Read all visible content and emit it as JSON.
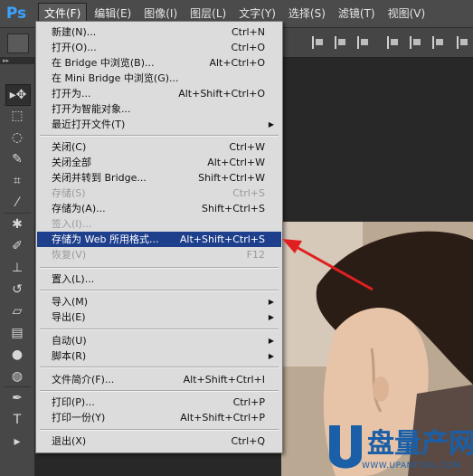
{
  "app": {
    "logo": "Ps"
  },
  "menubar": {
    "items": [
      {
        "label": "文件(F)"
      },
      {
        "label": "编辑(E)"
      },
      {
        "label": "图像(I)"
      },
      {
        "label": "图层(L)"
      },
      {
        "label": "文字(Y)"
      },
      {
        "label": "选择(S)"
      },
      {
        "label": "滤镜(T)"
      },
      {
        "label": "视图(V)"
      }
    ]
  },
  "panel_strip": {
    "label": "▸▸"
  },
  "toolbar": {
    "tools": [
      {
        "icon": "move-tool-icon",
        "glyph": "▸✥"
      },
      {
        "icon": "marquee-tool-icon",
        "glyph": "⬚"
      },
      {
        "icon": "lasso-tool-icon",
        "glyph": "◌"
      },
      {
        "icon": "quick-select-tool-icon",
        "glyph": "✎"
      },
      {
        "icon": "crop-tool-icon",
        "glyph": "⌗"
      },
      {
        "icon": "eyedropper-tool-icon",
        "glyph": "⁄"
      },
      {
        "icon": "healing-brush-tool-icon",
        "glyph": "✱"
      },
      {
        "icon": "brush-tool-icon",
        "glyph": "✐"
      },
      {
        "icon": "clone-stamp-tool-icon",
        "glyph": "⊥"
      },
      {
        "icon": "history-brush-tool-icon",
        "glyph": "↺"
      },
      {
        "icon": "eraser-tool-icon",
        "glyph": "▱"
      },
      {
        "icon": "gradient-tool-icon",
        "glyph": "▤"
      },
      {
        "icon": "blur-tool-icon",
        "glyph": "●"
      },
      {
        "icon": "dodge-tool-icon",
        "glyph": "◍"
      },
      {
        "icon": "pen-tool-icon",
        "glyph": "✒"
      },
      {
        "icon": "type-tool-icon",
        "glyph": "T"
      },
      {
        "icon": "path-select-tool-icon",
        "glyph": "▸"
      }
    ]
  },
  "file_menu": {
    "items": [
      {
        "label": "新建(N)...",
        "shortcut": "Ctrl+N",
        "disabled": false
      },
      {
        "label": "打开(O)...",
        "shortcut": "Ctrl+O",
        "disabled": false
      },
      {
        "label": "在 Bridge 中浏览(B)...",
        "shortcut": "Alt+Ctrl+O",
        "disabled": false
      },
      {
        "label": "在 Mini Bridge 中浏览(G)...",
        "shortcut": "",
        "disabled": false
      },
      {
        "label": "打开为...",
        "shortcut": "Alt+Shift+Ctrl+O",
        "disabled": false
      },
      {
        "label": "打开为智能对象...",
        "shortcut": "",
        "disabled": false
      },
      {
        "label": "最近打开文件(T)",
        "shortcut": "",
        "submenu": true,
        "disabled": false
      },
      {
        "label": "关闭(C)",
        "shortcut": "Ctrl+W",
        "disabled": false
      },
      {
        "label": "关闭全部",
        "shortcut": "Alt+Ctrl+W",
        "disabled": false
      },
      {
        "label": "关闭并转到 Bridge...",
        "shortcut": "Shift+Ctrl+W",
        "disabled": false
      },
      {
        "label": "存储(S)",
        "shortcut": "Ctrl+S",
        "disabled": true
      },
      {
        "label": "存储为(A)...",
        "shortcut": "Shift+Ctrl+S",
        "disabled": false
      },
      {
        "label": "签入(I)...",
        "shortcut": "",
        "disabled": true
      },
      {
        "label": "存储为 Web 所用格式...",
        "shortcut": "Alt+Shift+Ctrl+S",
        "disabled": false,
        "highlighted": true
      },
      {
        "label": "恢复(V)",
        "shortcut": "F12",
        "disabled": true
      },
      {
        "label": "置入(L)...",
        "shortcut": "",
        "disabled": false
      },
      {
        "label": "导入(M)",
        "shortcut": "",
        "submenu": true,
        "disabled": false
      },
      {
        "label": "导出(E)",
        "shortcut": "",
        "submenu": true,
        "disabled": false
      },
      {
        "label": "自动(U)",
        "shortcut": "",
        "submenu": true,
        "disabled": false
      },
      {
        "label": "脚本(R)",
        "shortcut": "",
        "submenu": true,
        "disabled": false
      },
      {
        "label": "文件简介(F)...",
        "shortcut": "Alt+Shift+Ctrl+I",
        "disabled": false
      },
      {
        "label": "打印(P)...",
        "shortcut": "Ctrl+P",
        "disabled": false
      },
      {
        "label": "打印一份(Y)",
        "shortcut": "Alt+Shift+Ctrl+P",
        "disabled": false
      },
      {
        "label": "退出(X)",
        "shortcut": "Ctrl+Q",
        "disabled": false
      }
    ],
    "submenu_arrow": "▶"
  },
  "watermark": {
    "brand": "盘量产网",
    "url": "WWW.UPANTOOL.COM"
  },
  "colors": {
    "highlight": "#1e3f8c",
    "annotation_arrow": "#e02020",
    "logo": "#3aa2ff"
  }
}
